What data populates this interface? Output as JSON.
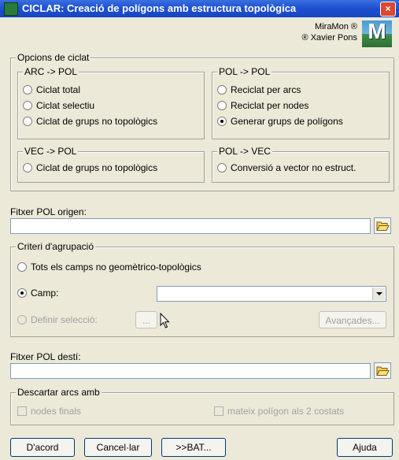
{
  "window": {
    "title": "CICLAR: Creació de polígons amb estructura topològica",
    "close": "×"
  },
  "brand": {
    "line1": "MiraMon ®",
    "line2": "® Xavier Pons",
    "logo_letter": "M"
  },
  "opcions": {
    "legend": "Opcions de ciclat",
    "arc_pol": {
      "legend": "ARC -> POL",
      "items": [
        "Ciclat total",
        "Ciclat selectiu",
        "Ciclat de grups no topològics"
      ]
    },
    "pol_pol": {
      "legend": "POL -> POL",
      "items": [
        "Reciclat per arcs",
        "Reciclat per nodes",
        "Generar grups de polígons"
      ],
      "selected_index": 2
    },
    "vec_pol": {
      "legend": "VEC -> POL",
      "items": [
        "Ciclat de grups no topològics"
      ]
    },
    "pol_vec": {
      "legend": "POL -> VEC",
      "items": [
        "Conversió a vector no estruct."
      ]
    }
  },
  "fitxer_origen": {
    "label": "Fitxer POL origen:",
    "value": ""
  },
  "criteri": {
    "legend": "Criteri d'agrupació",
    "tots": "Tots els camps no geomètrico-topològics",
    "camp": "Camp:",
    "camp_value": "",
    "definir": "Definir selecció:",
    "ellipsis": "...",
    "avancades": "Avançades..."
  },
  "fitxer_desti": {
    "label": "Fitxer POL destí:",
    "value": ""
  },
  "descartar": {
    "legend": "Descartar arcs amb",
    "nodes": "nodes finals",
    "mateix": "mateix polígon als 2 costats"
  },
  "buttons": {
    "ok": "D'acord",
    "cancel": "Cancel·lar",
    "bat": ">>BAT...",
    "help": "Ajuda"
  }
}
